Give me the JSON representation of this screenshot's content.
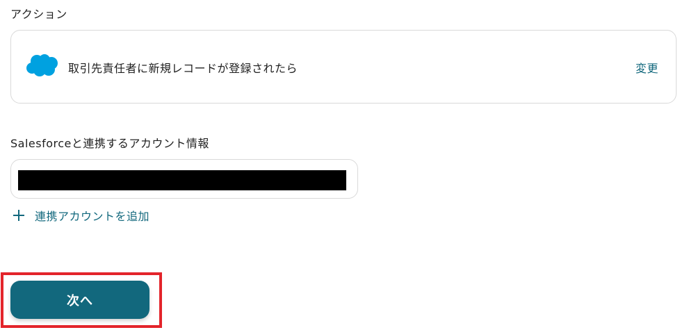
{
  "action_section": {
    "label": "アクション",
    "app_icon": "salesforce-cloud-icon",
    "action_title": "取引先責任者に新規レコードが登録されたら",
    "change_label": "変更"
  },
  "account_section": {
    "label": "Salesforceと連携するアカウント情報",
    "selected_account": "[redacted]",
    "add_account_icon": "plus-icon",
    "add_account_label": "連携アカウントを追加"
  },
  "footer": {
    "next_label": "次へ"
  },
  "colors": {
    "accent": "#12687d",
    "salesforce_blue": "#00a1e0",
    "highlight_red": "#e3242b",
    "border": "#d9d9d9"
  }
}
